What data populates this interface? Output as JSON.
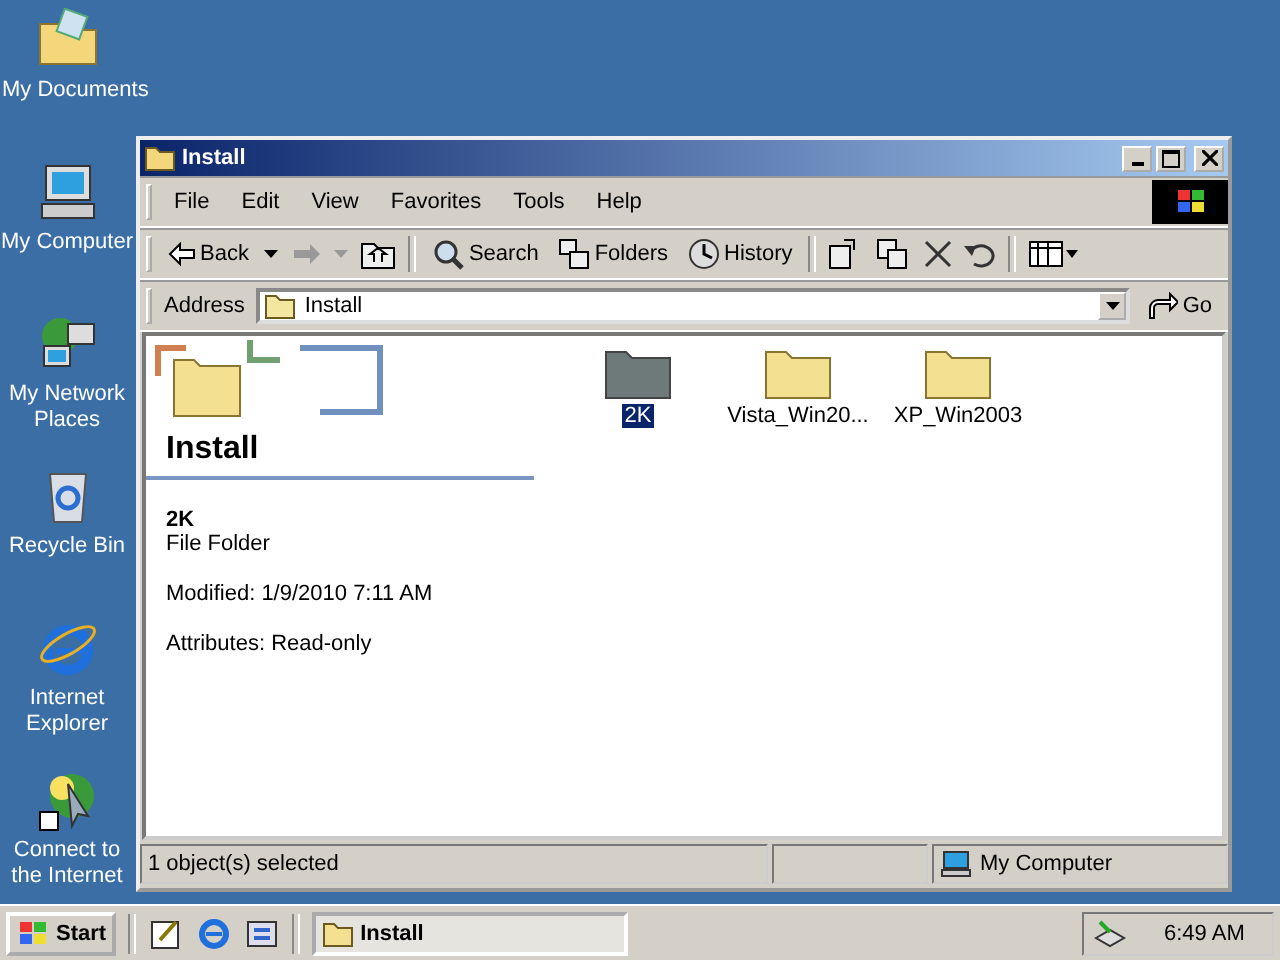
{
  "desktop_icons": [
    {
      "label": "My Documents",
      "kind": "documents"
    },
    {
      "label": "My Computer",
      "kind": "computer"
    },
    {
      "label": "My Network Places",
      "kind": "network"
    },
    {
      "label": "Recycle Bin",
      "kind": "recycle"
    },
    {
      "label": "Internet Explorer",
      "kind": "ie"
    },
    {
      "label": "Connect to the Internet",
      "kind": "connect"
    }
  ],
  "window": {
    "title": "Install",
    "menu": [
      "File",
      "Edit",
      "View",
      "Favorites",
      "Tools",
      "Help"
    ],
    "toolbar": {
      "back": "Back",
      "search": "Search",
      "folders": "Folders",
      "history": "History"
    },
    "address": {
      "label": "Address",
      "value": "Install",
      "go": "Go"
    },
    "info_panel": {
      "title": "Install",
      "name": "2K",
      "type": "File Folder",
      "modified": "Modified: 1/9/2010 7:11 AM",
      "attributes": "Attributes: Read-only"
    },
    "files": [
      {
        "name": "2K",
        "selected": true
      },
      {
        "name": "Vista_Win20...",
        "selected": false
      },
      {
        "name": "XP_Win2003",
        "selected": false
      }
    ],
    "status_bar": {
      "text": "1 object(s) selected",
      "zone": "My Computer"
    }
  },
  "taskbar": {
    "start": "Start",
    "tasks": [
      {
        "label": "Install",
        "selected": true
      }
    ],
    "clock": "6:49 AM"
  }
}
